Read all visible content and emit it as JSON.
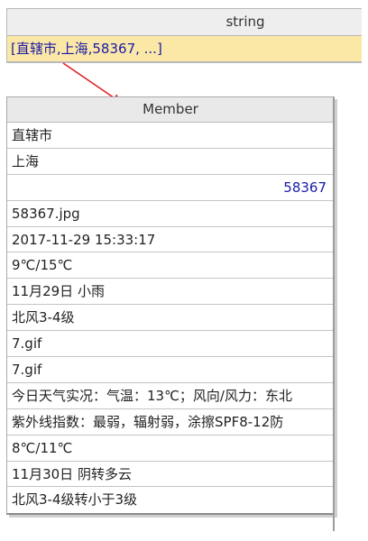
{
  "top_table": {
    "header": "string",
    "row_value": "[直辖市,上海,58367, ...]"
  },
  "member_table": {
    "header": "Member",
    "rows": [
      {
        "value": "直辖市",
        "align": "left"
      },
      {
        "value": "上海",
        "align": "left"
      },
      {
        "value": "58367",
        "align": "right"
      },
      {
        "value": "58367.jpg",
        "align": "left"
      },
      {
        "value": "2017-11-29 15:33:17",
        "align": "left"
      },
      {
        "value": "9℃/15℃",
        "align": "left"
      },
      {
        "value": "11月29日 小雨",
        "align": "left"
      },
      {
        "value": "北风3-4级",
        "align": "left"
      },
      {
        "value": "7.gif",
        "align": "left"
      },
      {
        "value": "7.gif",
        "align": "left"
      },
      {
        "value": "今日天气实况：气温：13℃；风向/风力：东北",
        "align": "left"
      },
      {
        "value": "紫外线指数：最弱，辐射弱，涂擦SPF8-12防",
        "align": "left"
      },
      {
        "value": "8℃/11℃",
        "align": "left"
      },
      {
        "value": "11月30日 阴转多云",
        "align": "left"
      },
      {
        "value": "北风3-4级转小于3级",
        "align": "left"
      }
    ]
  },
  "colors": {
    "highlight_row": "#fbe8a6",
    "link_text": "#1a1aa8",
    "arrow": "#e02020",
    "header_bg": "#eeeeee"
  }
}
